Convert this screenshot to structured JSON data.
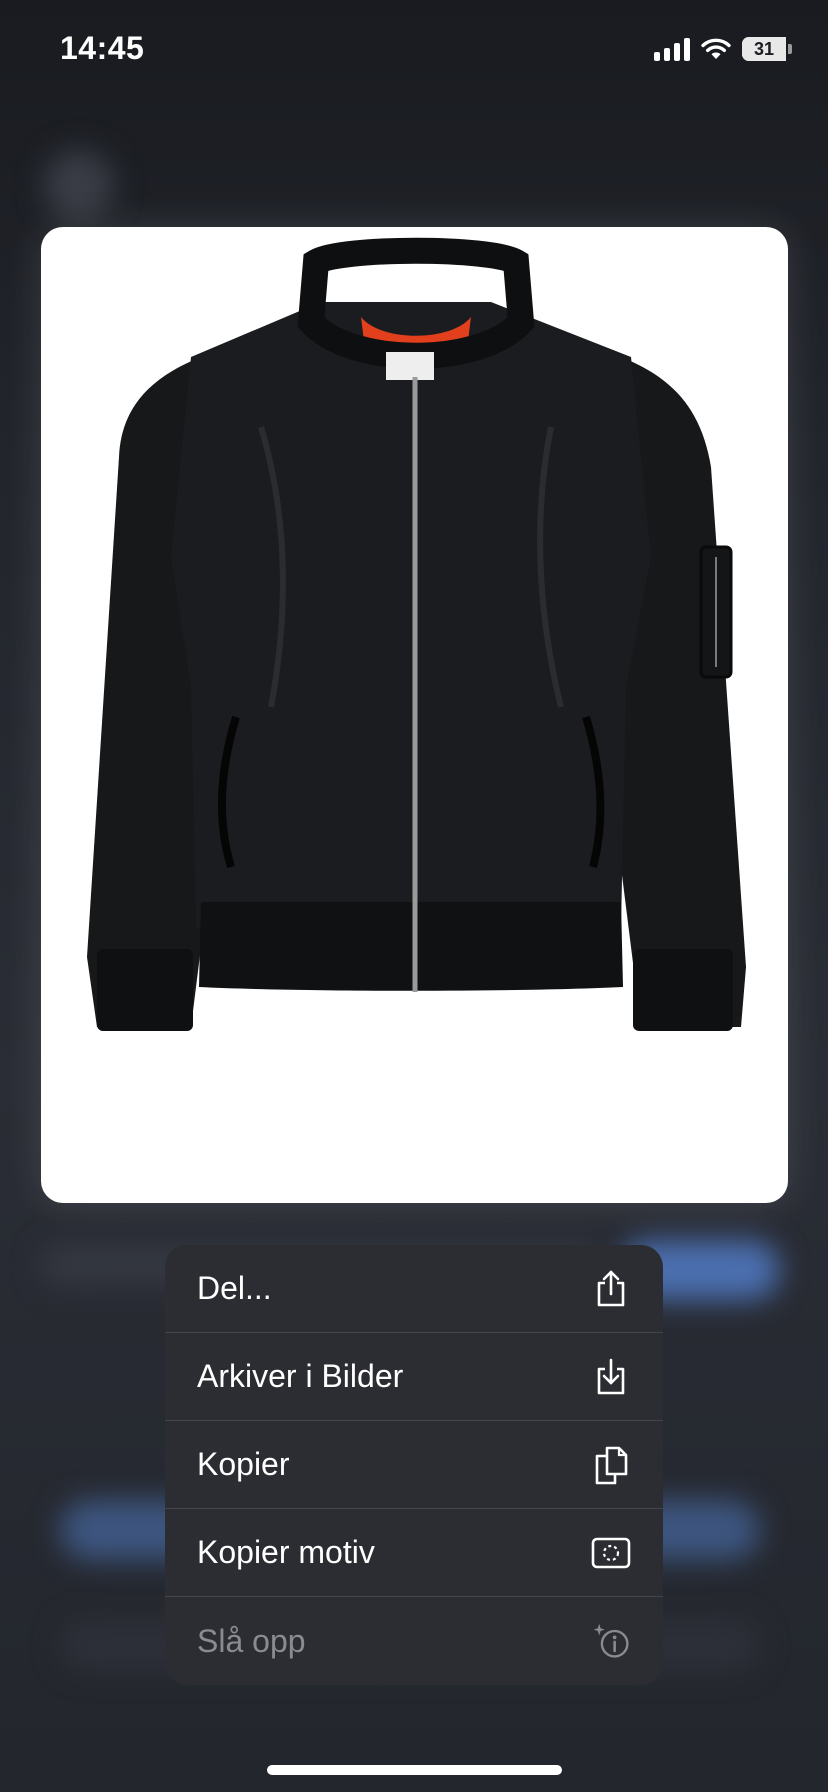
{
  "status_bar": {
    "time": "14:45",
    "battery_level": "31",
    "signal_bars": 4,
    "wifi": "wifi-icon"
  },
  "image": {
    "subject_icon": "bomber-jacket-photo",
    "background_color": "#ffffff"
  },
  "context_menu": {
    "items": [
      {
        "label": "Del...",
        "icon": "share-icon",
        "enabled": true
      },
      {
        "label": "Arkiver i Bilder",
        "icon": "save-to-photos-icon",
        "enabled": true
      },
      {
        "label": "Kopier",
        "icon": "copy-icon",
        "enabled": true
      },
      {
        "label": "Kopier motiv",
        "icon": "copy-subject-icon",
        "enabled": true
      },
      {
        "label": "Slå opp",
        "icon": "visual-look-up-icon",
        "enabled": false
      }
    ]
  },
  "colors": {
    "menu_background": "#2c2d32",
    "menu_text": "#ffffff",
    "menu_text_disabled": "#8a8b90",
    "jacket": "#141517",
    "jacket_lining": "#e2401c"
  }
}
